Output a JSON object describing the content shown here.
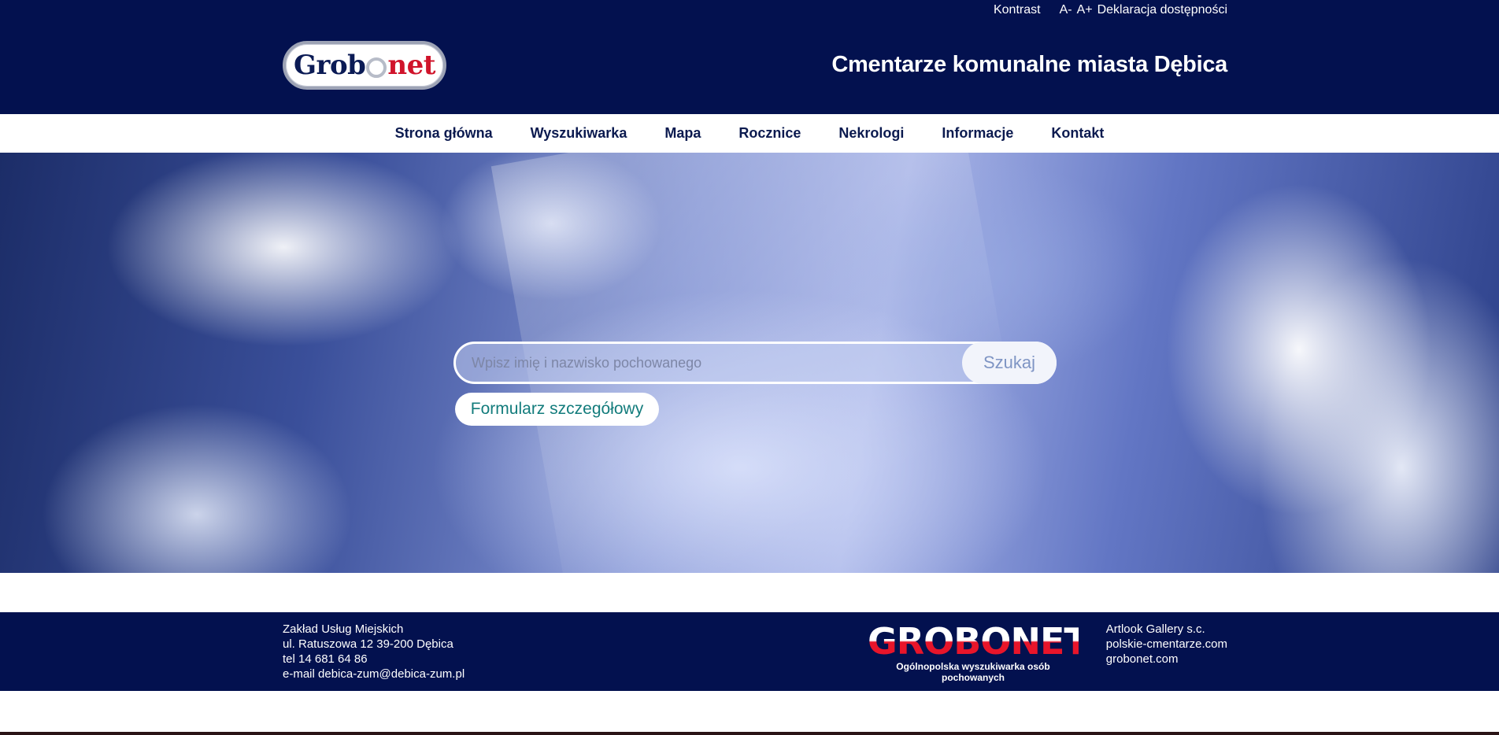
{
  "top": {
    "contrast": "Kontrast",
    "font_minus": "A-",
    "font_plus": "A+",
    "accessibility": "Deklaracja dostępności"
  },
  "logo": {
    "text_left": "Grob",
    "text_right": "net"
  },
  "site_title": "Cmentarze komunalne miasta Dębica",
  "nav": {
    "items": [
      "Strona główna",
      "Wyszukiwarka",
      "Mapa",
      "Rocznice",
      "Nekrologi",
      "Informacje",
      "Kontakt"
    ]
  },
  "search": {
    "placeholder": "Wpisz imię i nazwisko pochowanego",
    "button": "Szukaj",
    "detail_button": "Formularz szczegółowy"
  },
  "footer": {
    "address": [
      "Zakład Usług Miejskich",
      "ul. Ratuszowa 12 39-200 Dębica",
      "tel 14 681 64 86",
      "e-mail debica-zum@debica-zum.pl"
    ],
    "grobonet_big": "GROBONET",
    "grobonet_small": "Ogólnopolska wyszukiwarka osób pochowanych",
    "links": [
      "Artlook Gallery s.c.",
      "polskie-cmentarze.com",
      "grobonet.com"
    ]
  },
  "colors": {
    "navy": "#03114f",
    "accent_red": "#d0142b",
    "teal_button_text": "#137c7c"
  }
}
